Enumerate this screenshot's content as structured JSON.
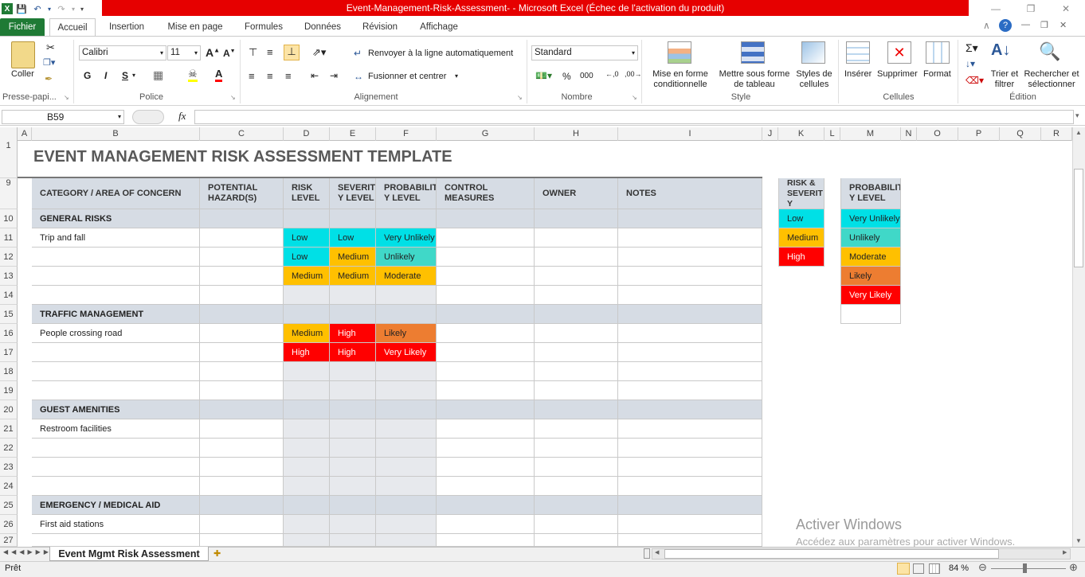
{
  "window": {
    "title": "Event-Management-Risk-Assessment-  -  Microsoft Excel (Échec de l'activation du produit)"
  },
  "menu": {
    "file": "Fichier",
    "tabs": [
      "Accueil",
      "Insertion",
      "Mise en page",
      "Formules",
      "Données",
      "Révision",
      "Affichage"
    ]
  },
  "ribbon": {
    "clipboard": {
      "paste": "Coller",
      "label": "Presse-papi..."
    },
    "font": {
      "name": "Calibri",
      "size": "11",
      "bold": "G",
      "italic": "I",
      "underline": "S",
      "label": "Police"
    },
    "alignment": {
      "wrap": "Renvoyer à la ligne automatiquement",
      "merge": "Fusionner et centrer",
      "label": "Alignement"
    },
    "number": {
      "format": "Standard",
      "percent": "%",
      "thousands": "000",
      "label": "Nombre"
    },
    "style": {
      "conditional": "Mise en forme conditionnelle",
      "table": "Mettre sous forme de tableau",
      "cellstyles": "Styles de cellules",
      "label": "Style"
    },
    "cells": {
      "insert": "Insérer",
      "delete": "Supprimer",
      "format": "Format",
      "label": "Cellules"
    },
    "editing": {
      "sort": "Trier et filtrer",
      "find": "Rechercher et sélectionner",
      "label": "Édition"
    }
  },
  "formula_bar": {
    "name_box": "B59",
    "fx": "fx",
    "value": ""
  },
  "columns": [
    "A",
    "B",
    "C",
    "D",
    "E",
    "F",
    "G",
    "H",
    "I",
    "J",
    "K",
    "L",
    "M",
    "N",
    "O",
    "P",
    "Q",
    "R"
  ],
  "sheet": {
    "title": "EVENT MANAGEMENT RISK ASSESSMENT TEMPLATE",
    "headers": {
      "category": "CATEGORY / AREA OF CONCERN",
      "hazard": "POTENTIAL HAZARD(S)",
      "risk": "RISK LEVEL",
      "severity": "SEVERIT Y LEVEL",
      "probability": "PROBABILIT Y LEVEL",
      "control": "CONTROL MEASURES",
      "owner": "OWNER",
      "notes": "NOTES"
    },
    "rows": [
      {
        "n": "10",
        "type": "cat",
        "b": "GENERAL RISKS"
      },
      {
        "n": "11",
        "b": "Trip and fall",
        "d": "Low",
        "e": "Low",
        "f": "Very Unlikely",
        "dc": "low-c",
        "ec": "low-c",
        "fc": "vu-c"
      },
      {
        "n": "12",
        "b": "",
        "d": "Low",
        "e": "Medium",
        "f": "Unlikely",
        "dc": "low-c",
        "ec": "med-c",
        "fc": "un-c"
      },
      {
        "n": "13",
        "b": "",
        "d": "Medium",
        "e": "Medium",
        "f": "Moderate",
        "dc": "med-c",
        "ec": "med-c",
        "fc": "mod-c"
      },
      {
        "n": "14",
        "b": ""
      },
      {
        "n": "15",
        "type": "cat",
        "b": "TRAFFIC MANAGEMENT"
      },
      {
        "n": "16",
        "b": "People crossing road",
        "d": "Medium",
        "e": "High",
        "f": "Likely",
        "dc": "med-c",
        "ec": "high-c",
        "fc": "lik-c"
      },
      {
        "n": "17",
        "b": "",
        "d": "High",
        "e": "High",
        "f": "Very Likely",
        "dc": "high-c",
        "ec": "high-c",
        "fc": "vl-c"
      },
      {
        "n": "18",
        "b": ""
      },
      {
        "n": "19",
        "b": ""
      },
      {
        "n": "20",
        "type": "cat",
        "b": "GUEST AMENITIES"
      },
      {
        "n": "21",
        "b": "Restroom facilities"
      },
      {
        "n": "22",
        "b": ""
      },
      {
        "n": "23",
        "b": ""
      },
      {
        "n": "24",
        "b": ""
      },
      {
        "n": "25",
        "type": "cat",
        "b": "EMERGENCY / MEDICAL AID"
      },
      {
        "n": "26",
        "b": "First aid stations"
      },
      {
        "n": "27",
        "b": ""
      }
    ],
    "legend_risk": {
      "header": "RISK & SEVERIT Y",
      "items": [
        {
          "t": "Low",
          "c": "low-c"
        },
        {
          "t": "Medium",
          "c": "med-c"
        },
        {
          "t": "High",
          "c": "high-c"
        }
      ]
    },
    "legend_prob": {
      "header": "PROBABILIT Y LEVEL",
      "items": [
        {
          "t": "Very Unlikely",
          "c": "vu-c"
        },
        {
          "t": "Unlikely",
          "c": "un-c"
        },
        {
          "t": "Moderate",
          "c": "mod-c"
        },
        {
          "t": "Likely",
          "c": "lik-c"
        },
        {
          "t": "Very Likely",
          "c": "vl-c"
        }
      ]
    }
  },
  "sheet_tab": "Event Mgmt Risk Assessment",
  "status": {
    "ready": "Prêt",
    "zoom": "84 %"
  },
  "watermark": {
    "line1": "Activer Windows",
    "line2": "Accédez aux paramètres pour activer Windows."
  },
  "colors": {
    "accent": "#1f7a35",
    "titlebar": "#e60000",
    "header_fill": "#d6dce4"
  }
}
